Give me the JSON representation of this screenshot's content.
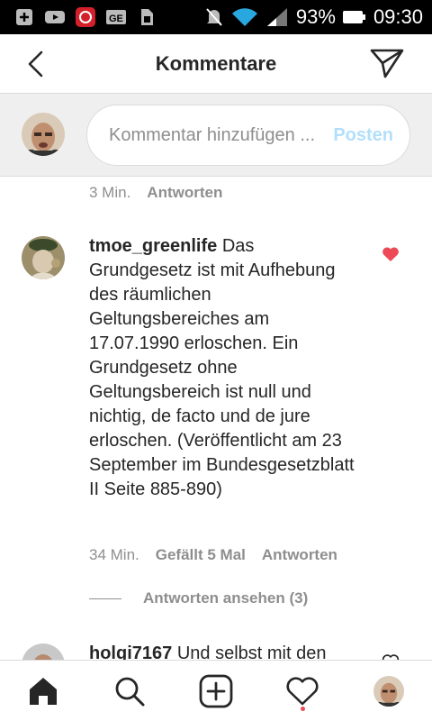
{
  "status_bar": {
    "battery": "93%",
    "time": "09:30",
    "icons": [
      "add-icon",
      "youtube-icon",
      "app-icon",
      "gmail-icon",
      "sim-icon",
      "mute-icon",
      "wifi-icon",
      "signal-icon",
      "battery-icon"
    ]
  },
  "header": {
    "title": "Kommentare",
    "back_icon": "back-arrow-icon",
    "direct_icon": "direct-message-icon"
  },
  "composer": {
    "placeholder": "Kommentar hinzufügen ...",
    "post_label": "Posten"
  },
  "previous_comment": {
    "time": "3 Min.",
    "reply_label": "Antworten"
  },
  "comments": [
    {
      "username": "tmoe_greenlife",
      "text": "Das Grundgesetz ist mit Aufhebung des räumlichen Geltungsbereiches am 17.07.1990 erloschen. Ein Grundgesetz ohne Geltungsbereich ist null und nichtig, de facto und de jure erloschen. (Veröffentlicht am 23 September im Bundesgesetzblatt II Seite 885-890)",
      "time": "34 Min.",
      "likes": "Gefällt 5 Mal",
      "reply_label": "Antworten",
      "view_replies": "Antworten ansehen (3)",
      "liked": true
    },
    {
      "username": "holgi7167",
      "text": "Und selbst mit den",
      "liked": false
    }
  ],
  "bottom_nav": {
    "items": [
      "home-icon",
      "search-icon",
      "add-post-icon",
      "activity-icon",
      "profile-avatar"
    ]
  },
  "colors": {
    "like_red": "#ed4956",
    "post_blue_disabled": "#b2dffc",
    "secondary_text": "#8e8e8e"
  }
}
